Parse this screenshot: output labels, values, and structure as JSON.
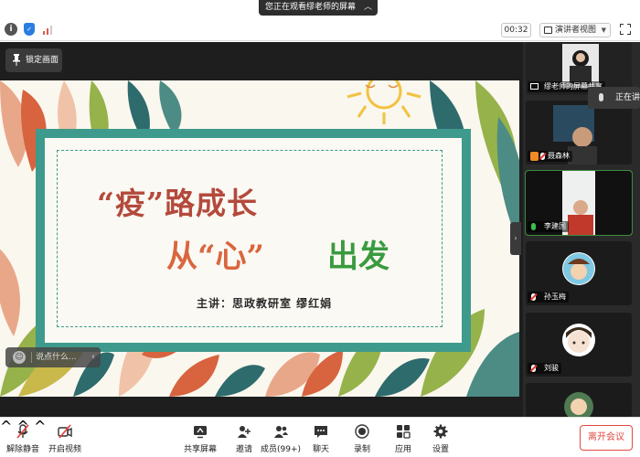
{
  "share_banner": {
    "text": "您正在观看缪老师的屏幕"
  },
  "status": {
    "timer": "00:32",
    "view_mode": "演讲者视图"
  },
  "lock_button": {
    "label": "锁定画面"
  },
  "slide": {
    "title_line1": "“疫”路成长",
    "title_line2_part1": "从“心”",
    "title_line2_part2": "出发",
    "speaker": "主讲：思政教研室  缪红娟"
  },
  "chat": {
    "placeholder": "说点什么..."
  },
  "speaking_tip": {
    "label": "正在讲"
  },
  "participants": [
    {
      "name": "缪老师的屏幕共享",
      "mic": "screen"
    },
    {
      "name": "聂森林",
      "mic": "muted"
    },
    {
      "name": "李建国",
      "mic": "on"
    },
    {
      "name": "孙玉梅",
      "mic": "muted"
    },
    {
      "name": "刘骏",
      "mic": "muted"
    },
    {
      "name": "",
      "mic": "none"
    }
  ],
  "toolbar": {
    "unmute": "解除静音",
    "video": "开启视频",
    "share": "共享屏幕",
    "invite": "邀请",
    "members": "成员(99+)",
    "chat": "聊天",
    "record": "录制",
    "apps": "应用",
    "settings": "设置",
    "leave": "离开会议"
  },
  "colors": {
    "slide_frame": "#3e9a8c",
    "title_red": "#b34a3c",
    "title_orange": "#d9663f",
    "title_green": "#3a9a3f",
    "leave_red": "#e04a3f",
    "active_green": "#3c8b3c"
  }
}
